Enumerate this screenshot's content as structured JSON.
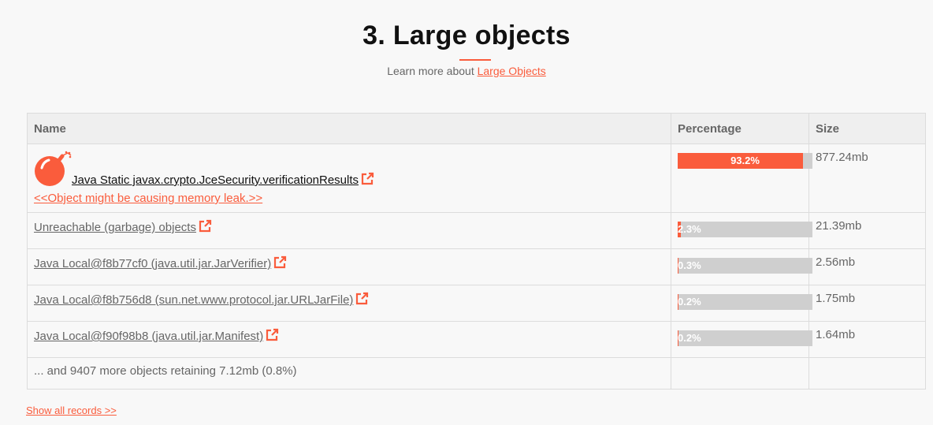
{
  "section": {
    "title": "3. Large objects",
    "learn_more_prefix": "Learn more about ",
    "learn_more_link": "Large Objects"
  },
  "table": {
    "headers": {
      "name": "Name",
      "percentage": "Percentage",
      "size": "Size"
    },
    "rows": [
      {
        "name": "Java Static javax.crypto.JceSecurity.verificationResults",
        "warning": "<<Object might be causing memory leak.>>",
        "percent_label": "93.2%",
        "percent": 93.2,
        "size": "877.24mb"
      },
      {
        "name": "Unreachable (garbage) objects",
        "percent_label": "2.3%",
        "percent": 2.3,
        "size": "21.39mb"
      },
      {
        "name": "Java Local@f8b77cf0 (java.util.jar.JarVerifier)",
        "percent_label": "0.3%",
        "percent": 0.3,
        "size": "2.56mb"
      },
      {
        "name": "Java Local@f8b756d8 (sun.net.www.protocol.jar.URLJarFile)",
        "percent_label": "0.2%",
        "percent": 0.2,
        "size": "1.75mb"
      },
      {
        "name": "Java Local@f90f98b8 (java.util.jar.Manifest)",
        "percent_label": "0.2%",
        "percent": 0.2,
        "size": "1.64mb"
      }
    ],
    "more_text": "... and 9407 more objects retaining 7.12mb (0.8%)"
  },
  "show_all_label": "Show all records >>",
  "colors": {
    "accent": "#fa5c3c",
    "bar_background": "#cfcfcf"
  },
  "icons": {
    "leak": "bomb-icon",
    "external": "external-link-icon"
  }
}
